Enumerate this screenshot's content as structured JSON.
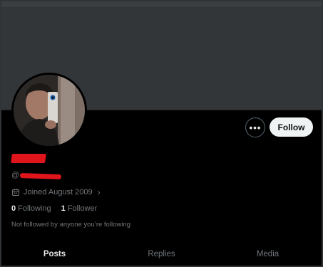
{
  "profile": {
    "display_name": "",
    "handle": "@",
    "joined": "Joined August 2009",
    "following_count": "0",
    "following_label": "Following",
    "followers_count": "1",
    "followers_label": "Follower",
    "not_followed_text": "Not followed by anyone you’re following"
  },
  "actions": {
    "more_label": "•••",
    "follow_label": "Follow"
  },
  "tabs": [
    {
      "label": "Posts",
      "active": true
    },
    {
      "label": "Replies",
      "active": false
    },
    {
      "label": "Media",
      "active": false
    }
  ],
  "icons": {
    "joined": "calendar-icon",
    "more": "ellipsis-icon",
    "joined_chevron": "chevron-right-icon"
  },
  "colors": {
    "background": "#000000",
    "banner": "#333639",
    "accent": "#1d9bf0",
    "redaction": "#e0141b",
    "follow_button": "#eff3f4",
    "muted_text": "#71767b"
  }
}
